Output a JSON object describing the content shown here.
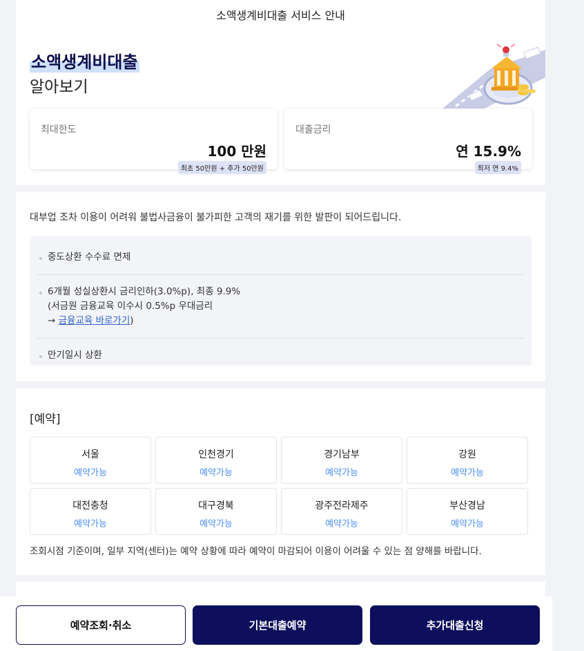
{
  "header": {
    "title": "소액생계비대출 서비스 안내"
  },
  "hero": {
    "title": "소액생계비대출",
    "subtitle": "알아보기",
    "cards": [
      {
        "label": "최대한도",
        "value": "100 만원",
        "note": "최초 50만원 + 추가 50만원"
      },
      {
        "label": "대출금리",
        "value": "연 15.9%",
        "note": "최저 연 9.4%"
      }
    ]
  },
  "info": {
    "intro": "대부업 조차 이용이 어려워 불법사금융이 불가피한 고객의 재기를 위한 발판이 되어드립니다.",
    "items": [
      {
        "line1": "중도상환 수수료 면제"
      },
      {
        "line1": "6개월 성실상환시 금리인하(3.0%p), 최종 9.9%",
        "line2": "(서금원 금융교육 이수시 0.5%p 우대금리",
        "arrow": "→ ",
        "link": "금융교육 바로가기",
        "close": ")"
      },
      {
        "line1": "만기일시 상환"
      }
    ]
  },
  "reserve": {
    "title": "[예약]",
    "regions": [
      {
        "name": "서울",
        "status": "예약가능"
      },
      {
        "name": "인천경기",
        "status": "예약가능"
      },
      {
        "name": "경기남부",
        "status": "예약가능"
      },
      {
        "name": "강원",
        "status": "예약가능"
      },
      {
        "name": "대전충청",
        "status": "예약가능"
      },
      {
        "name": "대구경북",
        "status": "예약가능"
      },
      {
        "name": "광주전라제주",
        "status": "예약가능"
      },
      {
        "name": "부산경남",
        "status": "예약가능"
      }
    ],
    "note": "조회시점 기준이며, 일부 지역(센터)는 예약 상황에 따라 예약이 마감되어 이용이 어려울 수 있는 점 양해를 바랍니다."
  },
  "bottom": {
    "btn1": "예약조회·취소",
    "btn2": "기본대출예약",
    "btn3": "추가대출신청"
  },
  "colors": {
    "navy": "#0d0f5c",
    "status_blue": "#4a8ef5",
    "highlight": "#cfe0fb"
  },
  "icons": [
    "bank-building-illustration",
    "siren-icon",
    "coin-stack-icon"
  ]
}
